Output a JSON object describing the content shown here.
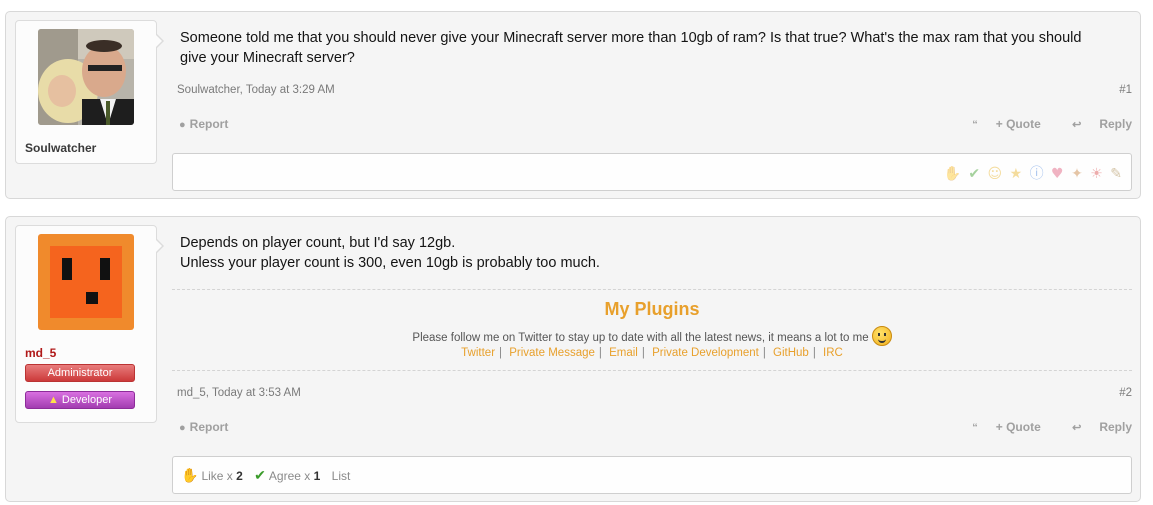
{
  "posts": [
    {
      "username": "Soulwatcher",
      "message_lines": [
        "Someone told me that you should never give your Minecraft server more than 10gb of ram? Is that true? What's the max ram that you should give your Minecraft server?"
      ],
      "meta": "Soulwatcher, Today at 3:29 AM",
      "number": "#1",
      "report_label": "Report",
      "quote_label": "+ Quote",
      "reply_label": "Reply",
      "rating_icons": [
        "like-icon",
        "agree-icon",
        "funny-icon",
        "winner-icon",
        "informative-icon",
        "friendly-icon",
        "useful-icon",
        "optimistic-icon",
        "creative-icon"
      ]
    },
    {
      "username": "md_5",
      "banners": [
        "Administrator",
        "Developer"
      ],
      "message_lines": [
        "Depends on player count, but I'd say 12gb.",
        "Unless your player count is 300, even 10gb is probably too much."
      ],
      "signature": {
        "title": "My Plugins",
        "line": "Please follow me on Twitter to stay up to date with all the latest news, it means a lot to me",
        "links": [
          "Twitter",
          "Private Message",
          "Email",
          "Private Development",
          "GitHub",
          "IRC"
        ]
      },
      "meta": "md_5, Today at 3:53 AM",
      "number": "#2",
      "report_label": "Report",
      "quote_label": "+ Quote",
      "reply_label": "Reply",
      "likes": {
        "like_label": "Like x",
        "like_count": "2",
        "agree_label": "Agree x",
        "agree_count": "1",
        "list_label": "List"
      }
    }
  ],
  "colors": {
    "signature_accent": "#e8a02c",
    "username_staff": "#b01818",
    "admin_banner": "#cc3a3a",
    "developer_banner": "#a23cb0"
  }
}
